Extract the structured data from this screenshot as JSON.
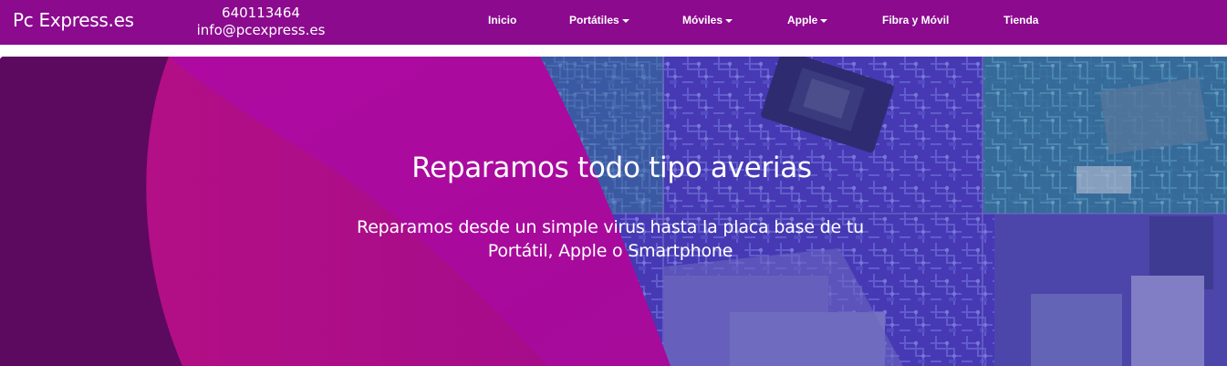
{
  "header": {
    "brand": "Pc Express.es",
    "phone": "640113464",
    "email": "info@pcexpress.es",
    "nav": [
      {
        "label": "Inicio",
        "dropdown": false
      },
      {
        "label": "Portátiles",
        "dropdown": true
      },
      {
        "label": "Móviles",
        "dropdown": true
      },
      {
        "label": "Apple",
        "dropdown": true
      },
      {
        "label": "Fibra y Móvil",
        "dropdown": false
      },
      {
        "label": "Tienda",
        "dropdown": false
      }
    ]
  },
  "hero": {
    "title": "Reparamos todo tipo averias",
    "subtitle": "Reparamos desde un simple virus hasta la placa base de tu Portátil, Apple o Smartphone"
  },
  "colors": {
    "navbar": "#8b0a8e",
    "accent_dark": "#5c0a5f",
    "accent_magenta": "#a20a93",
    "accent_pink": "#c0158e",
    "overlay_blue": "#4b3fb8"
  }
}
